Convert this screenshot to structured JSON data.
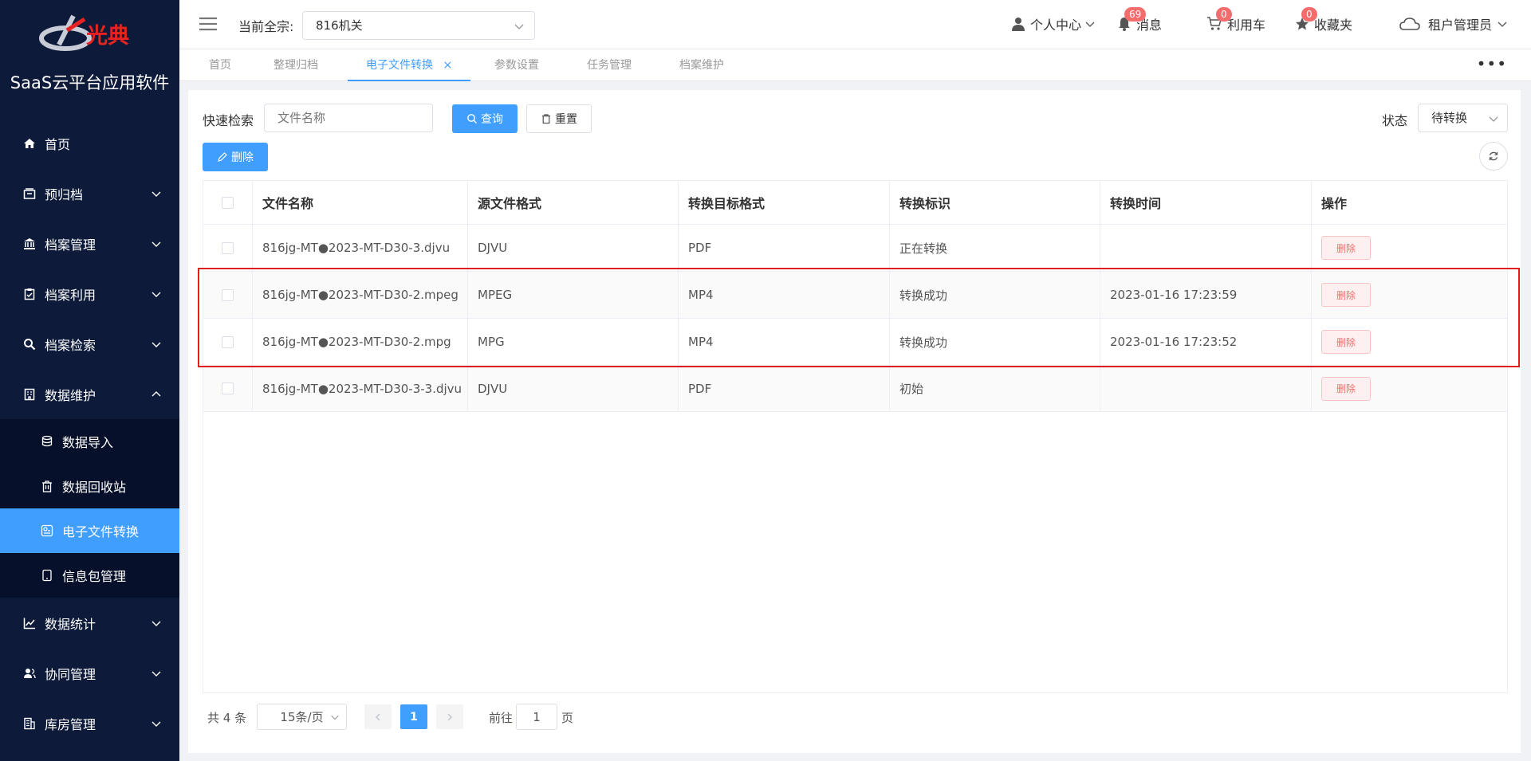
{
  "sidebar": {
    "logo_text": "光典",
    "app_title": "SaaS云平台应用软件",
    "menu": [
      {
        "label": "首页",
        "icon": "home-icon"
      },
      {
        "label": "预归档",
        "icon": "archive-box-icon"
      },
      {
        "label": "档案管理",
        "icon": "bank-icon"
      },
      {
        "label": "档案利用",
        "icon": "clipboard-check-icon"
      },
      {
        "label": "档案检索",
        "icon": "search-icon"
      },
      {
        "label": "数据维护",
        "icon": "building-icon"
      }
    ],
    "submenu": [
      {
        "label": "数据导入",
        "icon": "database-import-icon"
      },
      {
        "label": "数据回收站",
        "icon": "trash-icon"
      },
      {
        "label": "电子文件转换",
        "icon": "file-convert-icon"
      },
      {
        "label": "信息包管理",
        "icon": "tablet-icon"
      }
    ],
    "menu_after": [
      {
        "label": "数据统计",
        "icon": "line-chart-icon"
      },
      {
        "label": "协同管理",
        "icon": "users-icon"
      },
      {
        "label": "库房管理",
        "icon": "warehouse-icon"
      }
    ]
  },
  "header": {
    "clan_label": "当前全宗:",
    "clan_value": "816机关",
    "user_center": "个人中心",
    "messages": {
      "label": "消息",
      "count": "69"
    },
    "cart": {
      "label": "利用车",
      "count": "0"
    },
    "favorites": {
      "label": "收藏夹",
      "count": "0"
    },
    "tenant": "租户管理员"
  },
  "tabs": [
    {
      "label": "首页"
    },
    {
      "label": "整理归档"
    },
    {
      "label": "电子文件转换",
      "close": "×"
    },
    {
      "label": "参数设置"
    },
    {
      "label": "任务管理"
    },
    {
      "label": "档案维护"
    }
  ],
  "tabs_more": "•••",
  "toolbar": {
    "quick_search_label": "快速检索",
    "search_placeholder": "文件名称",
    "query_btn": "查询",
    "reset_btn": "重置",
    "status_label": "状态",
    "status_value": "待转换",
    "delete_btn": "删除"
  },
  "table": {
    "headers": [
      "文件名称",
      "源文件格式",
      "转换目标格式",
      "转换标识",
      "转换时间",
      "操作"
    ],
    "rows": [
      {
        "name": "816jg-MT●2023-MT-D30-3.djvu",
        "src": "DJVU",
        "target": "PDF",
        "flag": "正在转换",
        "time": "",
        "action": "删除"
      },
      {
        "name": "816jg-MT●2023-MT-D30-2.mpeg",
        "src": "MPEG",
        "target": "MP4",
        "flag": "转换成功",
        "time": "2023-01-16 17:23:59",
        "action": "删除"
      },
      {
        "name": "816jg-MT●2023-MT-D30-2.mpg",
        "src": "MPG",
        "target": "MP4",
        "flag": "转换成功",
        "time": "2023-01-16 17:23:52",
        "action": "删除"
      },
      {
        "name": "816jg-MT●2023-MT-D30-3-3.djvu",
        "src": "DJVU",
        "target": "PDF",
        "flag": "初始",
        "time": "",
        "action": "删除"
      }
    ]
  },
  "pagination": {
    "total": "共 4 条",
    "page_size": "15条/页",
    "current": "1",
    "goto_label": "前往",
    "goto_value": "1",
    "page_unit": "页"
  },
  "colors": {
    "primary": "#409eff",
    "sidebar_bg": "#0d1a3a",
    "danger": "#f56c6c",
    "highlight": "#e02020"
  }
}
